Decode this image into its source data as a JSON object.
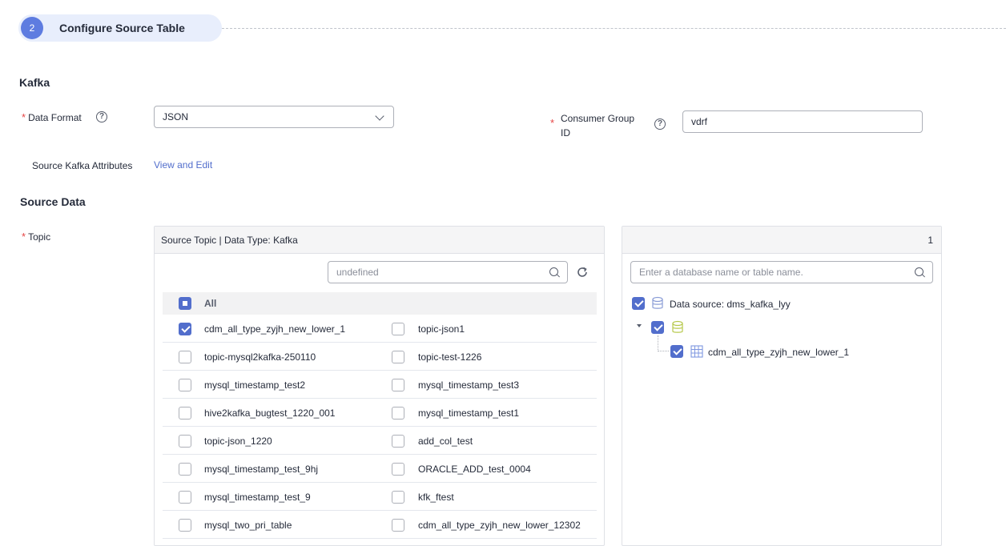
{
  "step": {
    "number": "2",
    "title": "Configure Source Table"
  },
  "kafka": {
    "section_title": "Kafka",
    "data_format_label": "Data Format",
    "data_format_value": "JSON",
    "consumer_group_label_line1": "Consumer Group",
    "consumer_group_label_line2": "ID",
    "consumer_group_value": "vdrf",
    "attributes_label": "Source Kafka Attributes",
    "attributes_link": "View and Edit"
  },
  "source_data": {
    "section_title": "Source Data",
    "topic_label": "Topic",
    "left_panel": {
      "header": "Source Topic | Data Type: Kafka",
      "search_placeholder": "undefined",
      "all_label": "All",
      "rows": [
        {
          "left": "cdm_all_type_zyjh_new_lower_1",
          "left_checked": true,
          "right": "topic-json1",
          "right_checked": false
        },
        {
          "left": "topic-mysql2kafka-250110",
          "left_checked": false,
          "right": "topic-test-1226",
          "right_checked": false
        },
        {
          "left": "mysql_timestamp_test2",
          "left_checked": false,
          "right": "mysql_timestamp_test3",
          "right_checked": false
        },
        {
          "left": "hive2kafka_bugtest_1220_001",
          "left_checked": false,
          "right": "mysql_timestamp_test1",
          "right_checked": false
        },
        {
          "left": "topic-json_1220",
          "left_checked": false,
          "right": "add_col_test",
          "right_checked": false
        },
        {
          "left": "mysql_timestamp_test_9hj",
          "left_checked": false,
          "right": "ORACLE_ADD_test_0004",
          "right_checked": false
        },
        {
          "left": "mysql_timestamp_test_9",
          "left_checked": false,
          "right": "kfk_ftest",
          "right_checked": false
        },
        {
          "left": "mysql_two_pri_table",
          "left_checked": false,
          "right": "cdm_all_type_zyjh_new_lower_12302",
          "right_checked": false
        }
      ]
    },
    "right_panel": {
      "count": "1",
      "search_placeholder": "Enter a database name or table name.",
      "datasource_label": "Data source: dms_kafka_lyy",
      "table_label": "cdm_all_type_zyjh_new_lower_1"
    }
  },
  "colors": {
    "primary": "#526ecc",
    "step_badge": "#5e7ce0",
    "required": "#e54545"
  },
  "icons": [
    "help-icon",
    "chevron-down-icon",
    "search-icon",
    "refresh-icon",
    "database-icon",
    "table-icon",
    "caret-down-icon"
  ]
}
